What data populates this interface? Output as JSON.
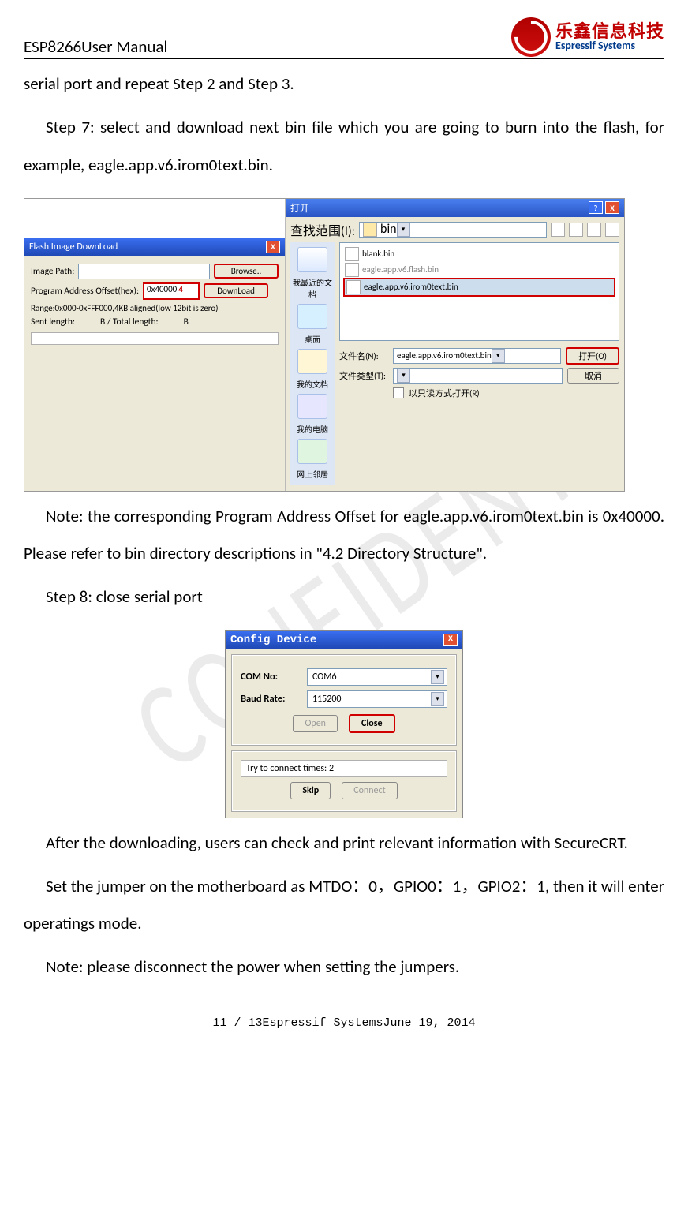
{
  "header": {
    "doc_title": "ESP8266User Manual",
    "logo_cn": "乐鑫信息科技",
    "logo_en": "Espressif Systems"
  },
  "paragraphs": {
    "p0": "serial port and repeat Step 2 and Step 3.",
    "p1": "Step 7: select and download next bin file which you are going to burn into the flash, for example, eagle.app.v6.irom0text.bin.",
    "p2": "Note: the corresponding Program Address Offset for eagle.app.v6.irom0text.bin is 0x40000. Please refer to bin directory descriptions in \"4.2 Directory Structure\".",
    "p3": "Step 8: close serial port",
    "p4": "After the downloading, users can check and print relevant information with SecureCRT.",
    "p5": "Set the jumper on the motherboard as MTDO：0，GPIO0：1，GPIO2：1, then it will enter operatings mode.",
    "p6": "Note: please disconnect the power when setting the jumpers."
  },
  "flash_dialog": {
    "title": "Flash Image DownLoad",
    "image_path_label": "Image Path:",
    "browse_btn": "Browse..",
    "addr_label": "Program Address Offset(hex):",
    "addr_value": "0x40000",
    "addr_annot": "4",
    "download_btn": "DownLoad",
    "range_note": "Range:0x000-0xFFF000,4KB aligned(low 12bit is zero)",
    "sent_label": "Sent length:",
    "sent_b1": "B / Total length:",
    "sent_b2": "B"
  },
  "open_dialog": {
    "title": "打开",
    "look_in_label": "查找范围(I):",
    "look_in_value": "bin",
    "side": {
      "recent": "我最近的文档",
      "desktop": "桌面",
      "mydocs": "我的文档",
      "mypc": "我的电脑",
      "network": "网上邻居"
    },
    "files": {
      "f1": "blank.bin",
      "f2": "eagle.app.v6.flash.bin",
      "f3": "eagle.app.v6.irom0text.bin"
    },
    "filename_label": "文件名(N):",
    "filename_value": "eagle.app.v6.irom0text.bin",
    "filetype_label": "文件类型(T):",
    "readonly_label": "以只读方式打开(R)",
    "open_btn": "打开(O)",
    "cancel_btn": "取消"
  },
  "config_dialog": {
    "title": "Config Device",
    "com_label": "COM No:",
    "com_value": "COM6",
    "baud_label": "Baud Rate:",
    "baud_value": "115200",
    "open_btn": "Open",
    "close_btn": "Close",
    "status": "Try to connect times: 2",
    "skip_btn": "Skip",
    "connect_btn": "Connect"
  },
  "footer": "11 / 13Espressif SystemsJune 19, 2014",
  "watermark": "CONFIDENT"
}
